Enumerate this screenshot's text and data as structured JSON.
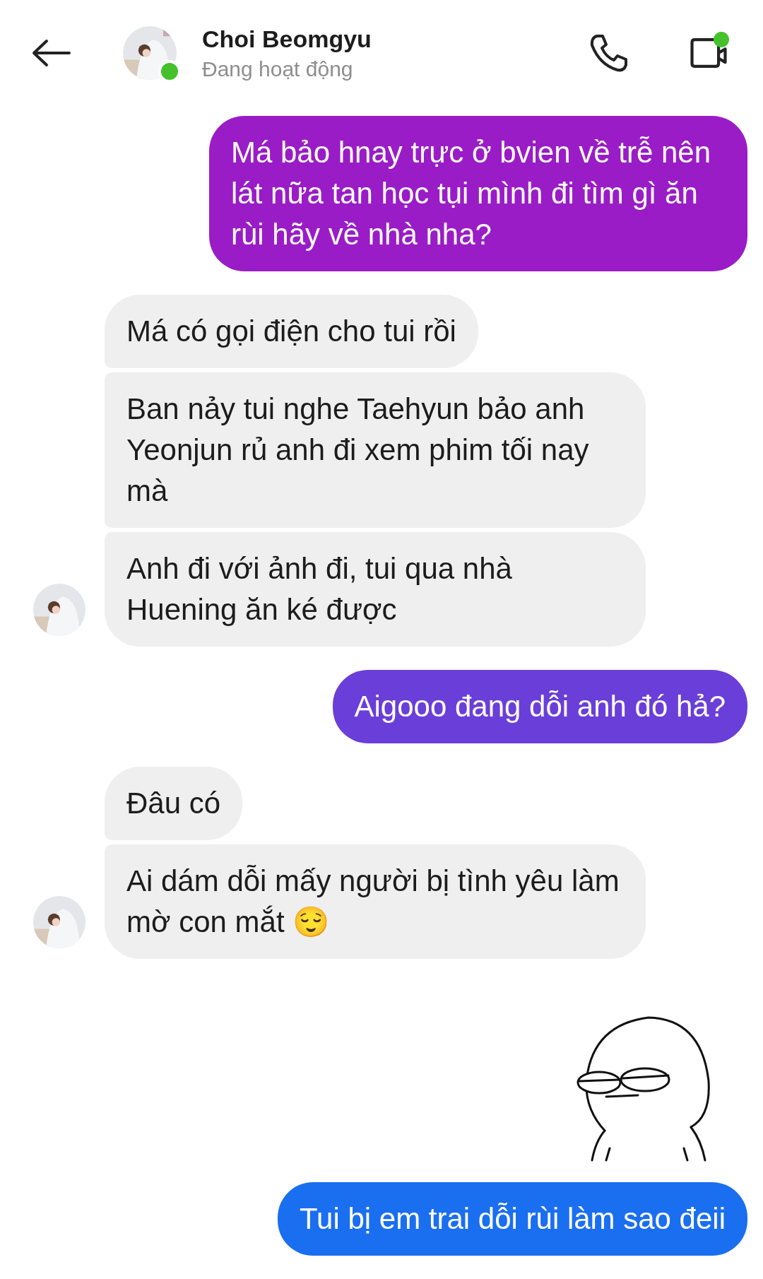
{
  "header": {
    "name": "Choi Beomgyu",
    "status": "Đang hoạt động",
    "online": true,
    "video_badge": true
  },
  "messages": [
    {
      "kind": "sent",
      "text": "Má bảo hnay trực ở bvien về trễ nên lát nữa tan học tụi mình đi tìm gì ăn rùi hãy về nhà nha?",
      "color": "#9a1cc6"
    },
    {
      "kind": "received",
      "bubbles": [
        {
          "text": "Má có gọi điện cho tui rồi"
        },
        {
          "text": "Ban nảy tui nghe Taehyun bảo anh Yeonjun rủ anh đi xem phim tối nay mà"
        },
        {
          "text": "Anh đi với ảnh đi, tui qua nhà Huening ăn ké được"
        }
      ]
    },
    {
      "kind": "sent",
      "text": "Aigooo đang dỗi anh đó hả?",
      "color": "#6a3ed8"
    },
    {
      "kind": "received",
      "bubbles": [
        {
          "text": "Đâu có"
        },
        {
          "text": "Ai dám dỗi mấy người bị tình yêu làm mờ con mắt 😌"
        }
      ]
    },
    {
      "kind": "sticker"
    },
    {
      "kind": "sent",
      "text": "Tui bị em trai dỗi rùi làm sao đeii",
      "color": "#1a6ef0"
    }
  ]
}
